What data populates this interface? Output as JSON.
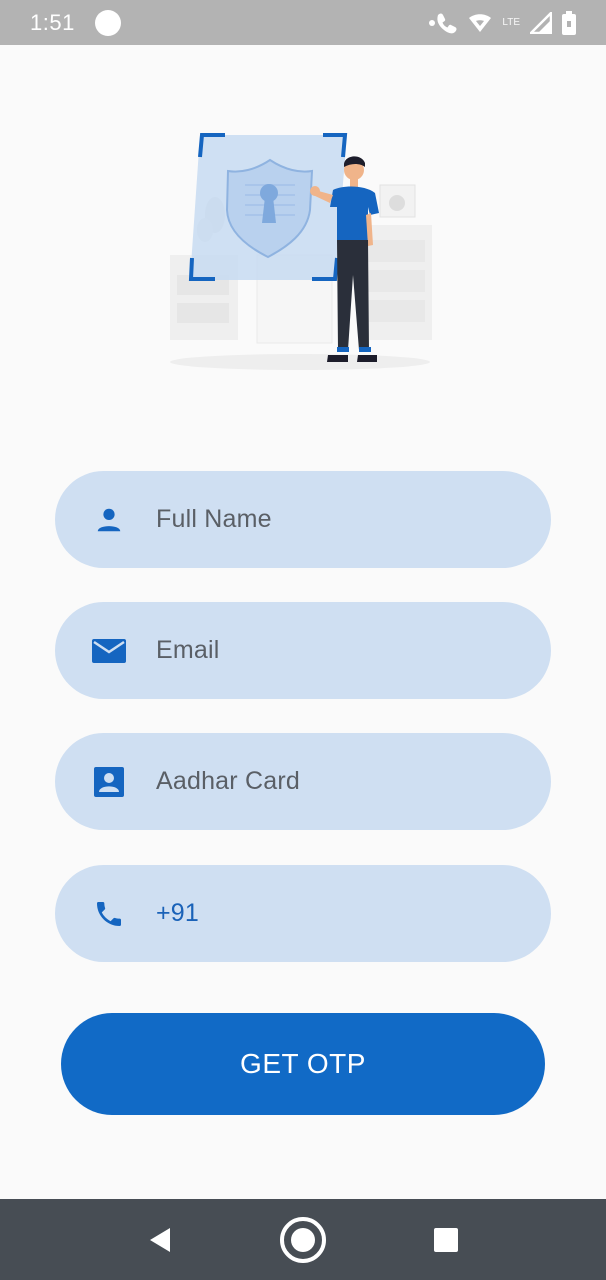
{
  "status_bar": {
    "time": "1:51",
    "icons": [
      "notification-dot",
      "wifi-calling-icon",
      "wifi-icon",
      "lte-icon",
      "signal-icon",
      "battery-icon"
    ],
    "lte_label": "LTE"
  },
  "illustration": {
    "name": "security-shield-illustration"
  },
  "form": {
    "fields": [
      {
        "icon": "person-icon",
        "placeholder": "Full Name"
      },
      {
        "icon": "email-icon",
        "placeholder": "Email"
      },
      {
        "icon": "id-card-icon",
        "placeholder": "Aadhar Card"
      },
      {
        "icon": "phone-icon",
        "value": "+91"
      }
    ],
    "submit_label": "GET OTP"
  },
  "nav_bar": {
    "buttons": [
      "back-icon",
      "home-icon",
      "recents-icon"
    ]
  },
  "colors": {
    "primary": "#116ac6",
    "field_bg": "#cfdff2",
    "icon": "#1565c0",
    "status_bar": "#b3b3b3",
    "nav_bar": "#474d54",
    "background": "#fafafa"
  }
}
